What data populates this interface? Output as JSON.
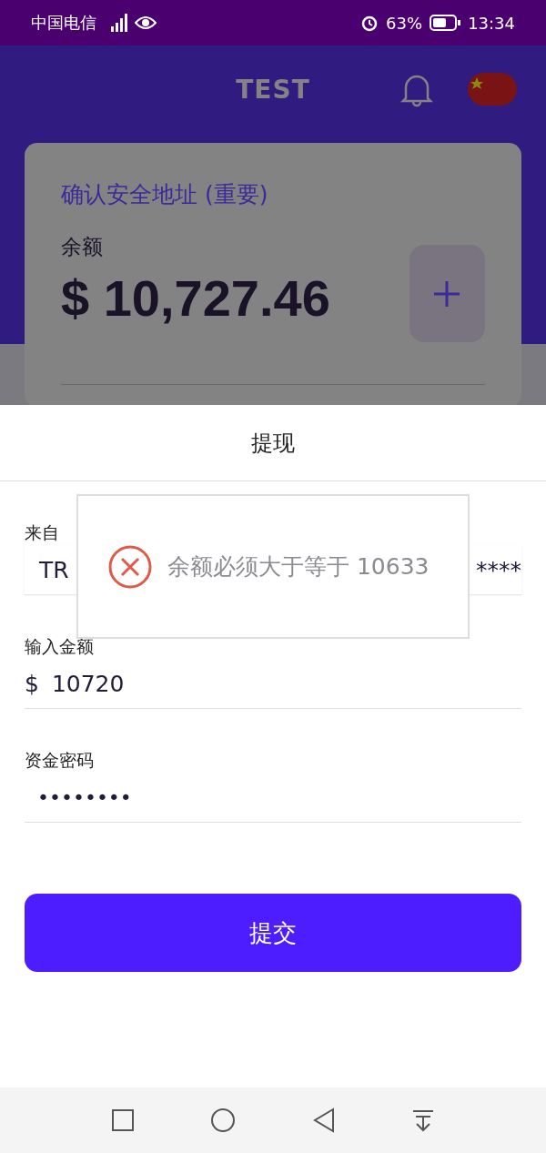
{
  "status_bar": {
    "carrier": "中国电信",
    "battery": "63%",
    "time": "13:34"
  },
  "header": {
    "title": "TEST"
  },
  "card": {
    "link": "确认安全地址 (重要)",
    "balance_label": "余额",
    "balance": "$ 10,727.46"
  },
  "sheet": {
    "title": "提现",
    "fields": [
      {
        "label": "来自",
        "kind": "select",
        "value_start": "TR",
        "value_end": "****"
      },
      {
        "label": "输入金额",
        "kind": "amount",
        "prefix": "$",
        "value": "10720"
      },
      {
        "label": "资金密码",
        "kind": "password",
        "value": "••••••••"
      }
    ],
    "submit": "提交"
  },
  "toast": {
    "message": "余额必须大于等于 10633"
  }
}
